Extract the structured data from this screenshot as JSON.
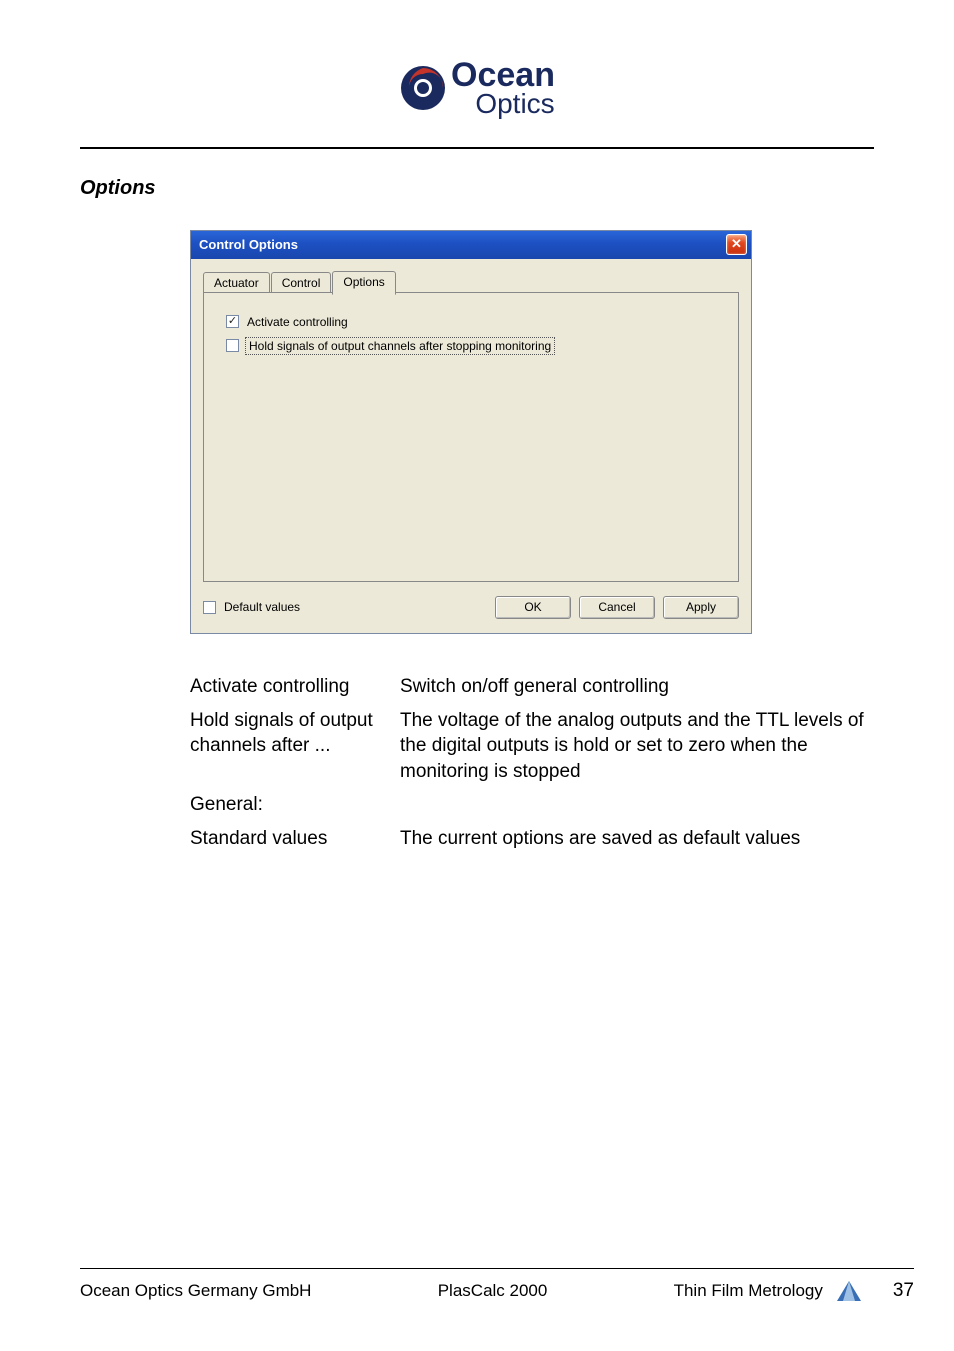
{
  "header": {
    "logo_top": "Ocean",
    "logo_bottom": "Optics"
  },
  "section_title": "Options",
  "dialog": {
    "title": "Control Options",
    "close_glyph": "✕",
    "tabs": {
      "actuator": "Actuator",
      "control": "Control",
      "options": "Options"
    },
    "chk_activate": {
      "label": "Activate controlling",
      "checked_glyph": "✓"
    },
    "chk_hold": {
      "label": "Hold signals of output channels after stopping monitoring"
    },
    "default_values": "Default values",
    "buttons": {
      "ok": "OK",
      "cancel": "Cancel",
      "apply": "Apply"
    }
  },
  "descriptions": {
    "activate_l": "Activate controlling",
    "activate_r": "Switch on/off general controlling",
    "hold_l": "Hold signals of output channels after ...",
    "hold_r": "The voltage of the analog outputs and the TTL levels of the digital outputs is hold or set to zero when the monitoring is stopped",
    "general": "General:",
    "std_l": "Standard values",
    "std_r": "The current options are saved as default values"
  },
  "footer": {
    "left": "Ocean Optics Germany GmbH",
    "center": "PlasCalc 2000",
    "right": "Thin Film Metrology",
    "page": "37"
  }
}
